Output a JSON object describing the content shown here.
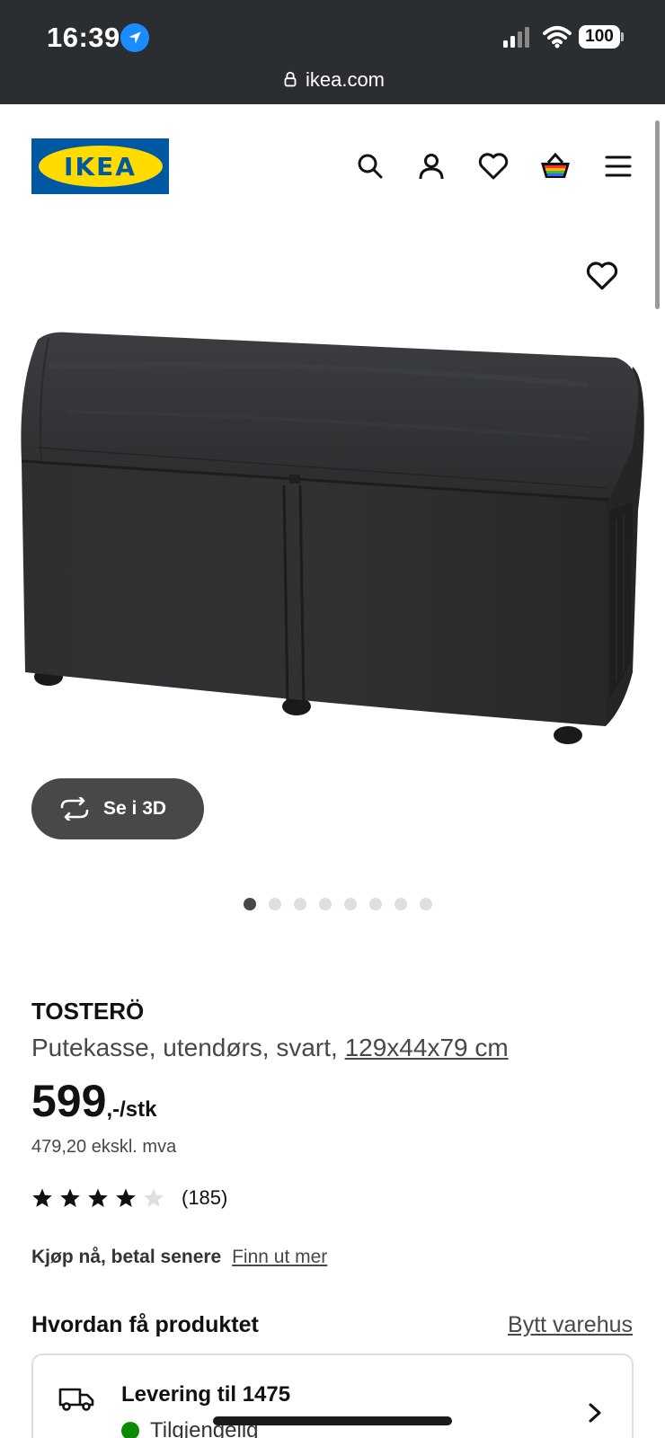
{
  "status_bar": {
    "time": "16:39",
    "battery": "100"
  },
  "url_bar": {
    "domain": "ikea.com"
  },
  "header": {
    "logo_text": "IKEA"
  },
  "gallery": {
    "view_3d_label": "Se i 3D",
    "image_count": 8,
    "active_index": 0
  },
  "product": {
    "name": "TOSTERÖ",
    "description": "Putekasse, utendørs, svart,",
    "dimensions": "129x44x79 cm",
    "price": "599",
    "price_suffix": ",-/stk",
    "price_ex_vat": "479,20 ekskl. mva",
    "rating": {
      "stars": 4,
      "max": 5,
      "count": "(185)"
    },
    "bnpl_text": "Kjøp nå, betal senere",
    "bnpl_link": "Finn ut mer"
  },
  "fulfillment": {
    "heading": "Hvordan få produktet",
    "change_store": "Bytt varehus",
    "delivery_title": "Levering til 1475",
    "availability": "Tilgjengelig"
  },
  "colors": {
    "ikea_blue": "#0058a3",
    "ikea_yellow": "#ffdb00",
    "status_bar": "#2b2e31",
    "available_green": "#0a8a00"
  }
}
